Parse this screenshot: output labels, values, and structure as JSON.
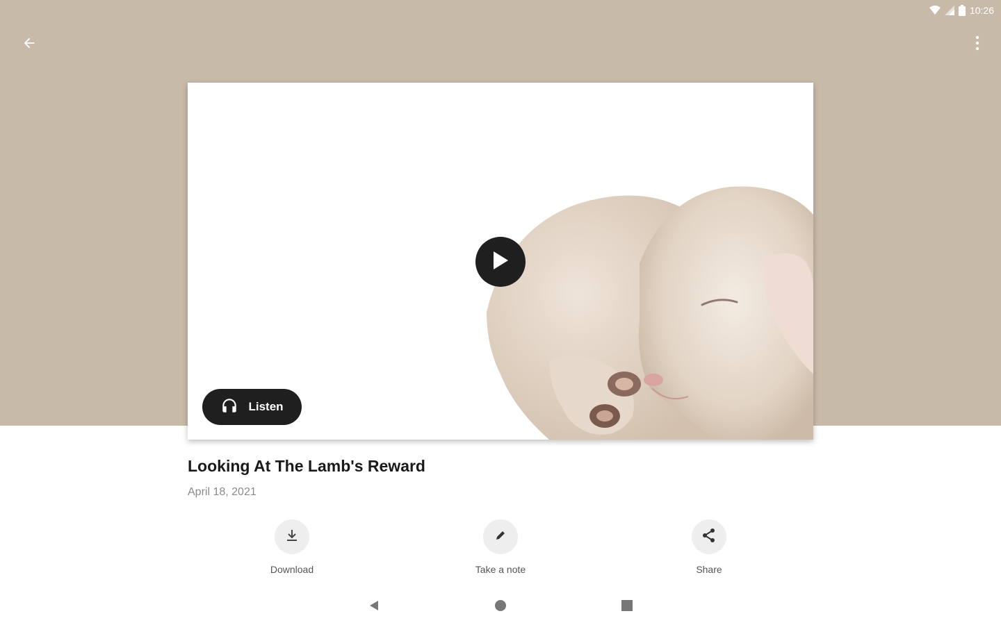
{
  "status_bar": {
    "time": "10:26",
    "icons": [
      "wifi-icon",
      "signal-icon",
      "battery-icon"
    ]
  },
  "toolbar": {
    "back_icon": "arrow-back-icon",
    "menu_icon": "more-vert-icon"
  },
  "media": {
    "image_subject": "sleeping lamb",
    "play_icon": "play-icon",
    "listen_label": "Listen",
    "listen_icon": "headphones-icon"
  },
  "sermon": {
    "title": "Looking At The Lamb's Reward",
    "date": "April 18, 2021"
  },
  "actions": [
    {
      "label": "Download",
      "icon": "download-icon"
    },
    {
      "label": "Take a note",
      "icon": "pencil-icon"
    },
    {
      "label": "Share",
      "icon": "share-icon"
    }
  ],
  "nav_bar": {
    "icons": [
      "nav-back-icon",
      "nav-home-icon",
      "nav-recents-icon"
    ]
  },
  "colors": {
    "header_background": "#c8baa9",
    "button_dark": "#1f1f1f",
    "action_circle": "#eeeeee"
  }
}
